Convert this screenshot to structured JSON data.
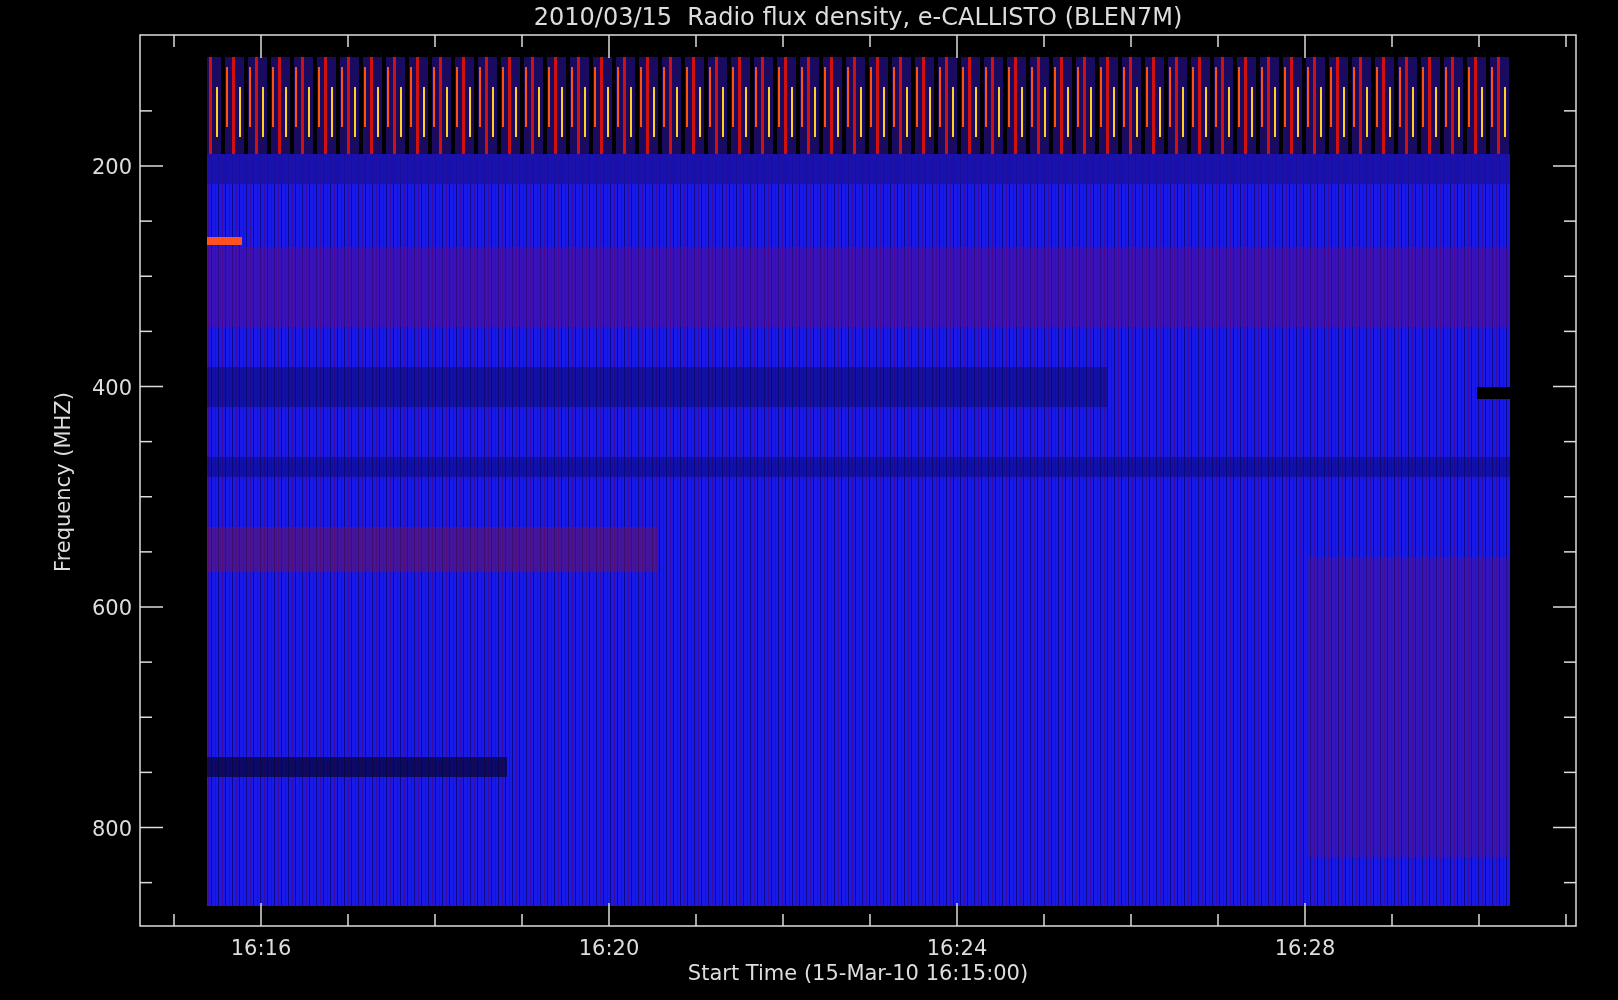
{
  "title": "2010/03/15  Radio flux density, e-CALLISTO (BLEN7M)",
  "y_axis": {
    "label": "Frequency (MHZ)",
    "ticks": [
      "200",
      "400",
      "600",
      "800"
    ]
  },
  "x_axis": {
    "label": "Start Time (15-Mar-10 16:15:00)",
    "ticks": [
      "16:16",
      "16:20",
      "16:24",
      "16:28"
    ]
  }
}
